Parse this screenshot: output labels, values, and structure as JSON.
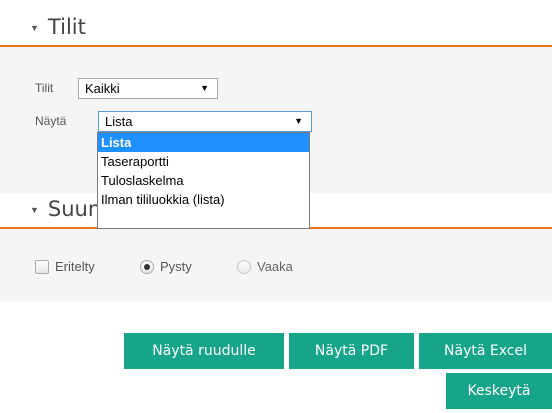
{
  "section1": {
    "title": "Tilit",
    "collapse_icon": "triangle-down-icon",
    "fields": {
      "tilit_label": "Tilit",
      "tilit_value": "Kaikki",
      "nayta_label": "Näytä",
      "nayta_value": "Lista"
    },
    "dropdown_options": [
      "Lista",
      "Taseraportti",
      "Tuloslaskelma",
      "Ilman tililuokkia (lista)"
    ],
    "dropdown_selected_index": 0
  },
  "section2": {
    "title": "Suun",
    "collapse_icon": "triangle-down-icon",
    "options": {
      "eritelty": "Eritelty",
      "pysty": "Pysty",
      "vaaka": "Vaaka"
    },
    "eritelty_checked": false,
    "orientation_selected": "Pysty"
  },
  "buttons": {
    "ruudulle": "Näytä ruudulle",
    "pdf": "Näytä PDF",
    "excel": "Näytä Excel",
    "keskeyta": "Keskeytä"
  },
  "colors": {
    "accent_line": "#e8741c",
    "button_bg": "#17a58a",
    "selected_option_bg": "#1e90ff"
  }
}
